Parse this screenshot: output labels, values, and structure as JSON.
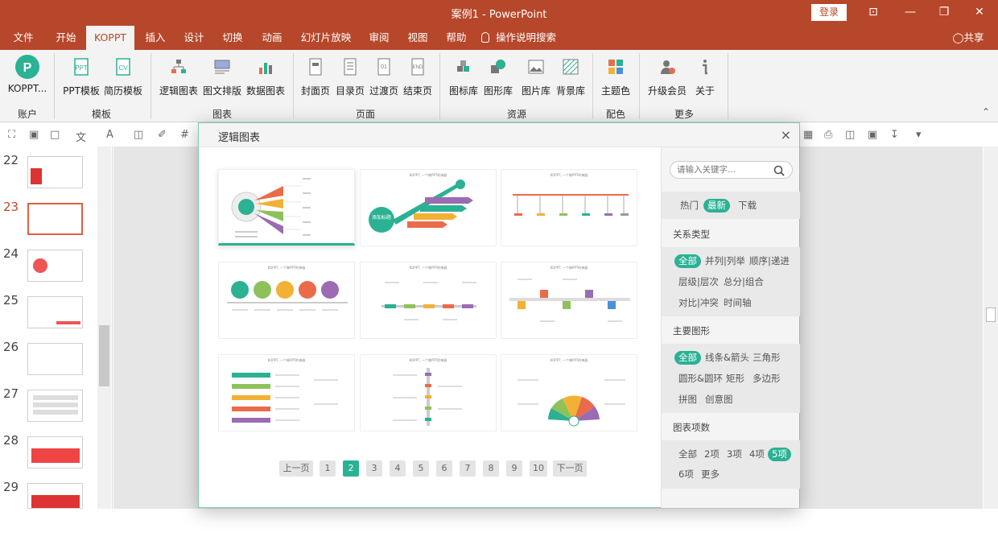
{
  "window": {
    "title": "案例1  -  PowerPoint",
    "login": "登录",
    "minimize": "—",
    "restore": "❐",
    "close": "✕",
    "ribbon_toggle": "⊡"
  },
  "menubar": {
    "tabs": [
      "文件",
      "开始",
      "KOPPT",
      "插入",
      "设计",
      "切换",
      "动画",
      "幻灯片放映",
      "审阅",
      "视图",
      "帮助"
    ],
    "active": "KOPPT",
    "search": "操作说明搜索",
    "share": "共享"
  },
  "ribbon": {
    "buttons": [
      "KOPPT...",
      "PPT模板",
      "简历模板",
      "逻辑图表",
      "图文排版",
      "数据图表",
      "封面页",
      "目录页",
      "过渡页",
      "结束页",
      "图标库",
      "图形库",
      "图片库",
      "背景库",
      "主题色",
      "升级会员",
      "关于"
    ],
    "groups": [
      "账户",
      "模板",
      "图表",
      "页面",
      "资源",
      "配色",
      "更多"
    ]
  },
  "slides": [
    {
      "num": "22"
    },
    {
      "num": "23",
      "current": true
    },
    {
      "num": "24"
    },
    {
      "num": "25"
    },
    {
      "num": "26"
    },
    {
      "num": "27"
    },
    {
      "num": "28"
    },
    {
      "num": "29"
    }
  ],
  "dialog": {
    "title": "逻辑图表",
    "close": "×",
    "template_caption": "KOPPT, 一个做PPT的神器",
    "card2_label": "添加标题",
    "pagination": [
      "上一页",
      "1",
      "2",
      "3",
      "4",
      "5",
      "6",
      "7",
      "8",
      "9",
      "10",
      "下一页"
    ],
    "current_page": "2",
    "search_placeholder": "请输入关键字...",
    "sort": {
      "options": [
        "热门",
        "最新",
        "下载"
      ],
      "active": "最新"
    },
    "relation": {
      "title": "关系类型",
      "options": [
        "全部",
        "并列|列举",
        "顺序|递进",
        "层级|层次",
        "总分|组合",
        "对比|冲突",
        "时间轴"
      ],
      "active": "全部"
    },
    "shape": {
      "title": "主要图形",
      "options": [
        "全部",
        "线条&箭头",
        "三角形",
        "圆形&圆环",
        "矩形",
        "多边形",
        "拼图",
        "创意图"
      ],
      "active": "全部"
    },
    "count": {
      "title": "图表项数",
      "options": [
        "全部",
        "2项",
        "3项",
        "4项",
        "5项",
        "6项",
        "更多"
      ],
      "active": "5项"
    }
  },
  "colors": {
    "accent": "#2bb193",
    "titlebar": "#b7472a"
  }
}
